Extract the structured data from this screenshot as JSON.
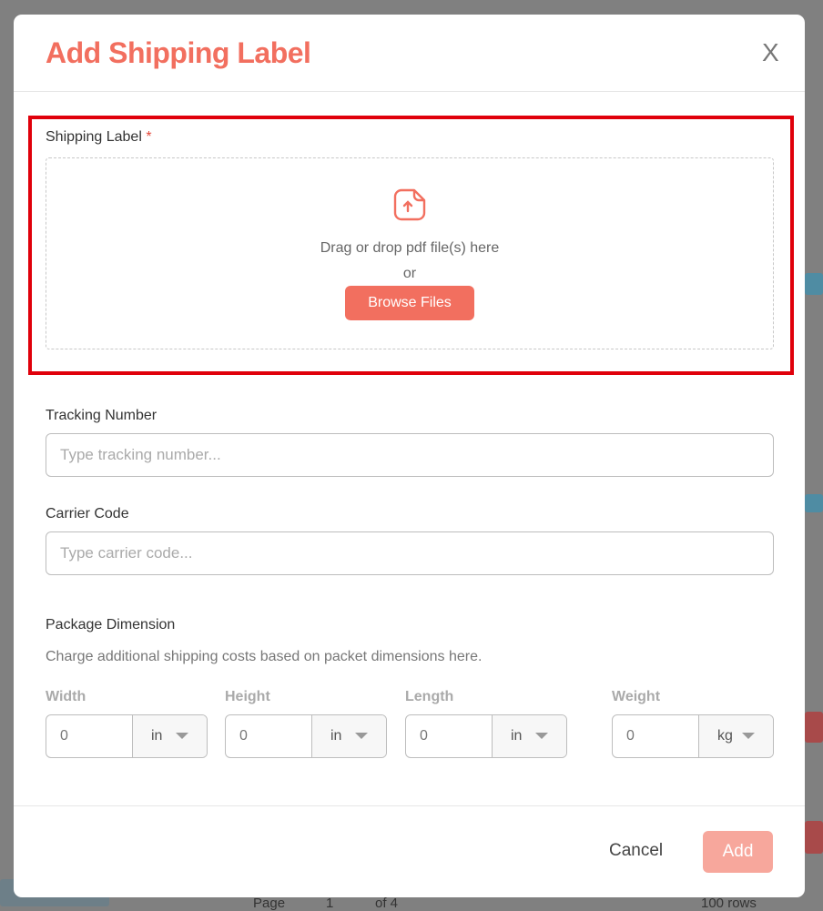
{
  "background": {
    "page_label": "Page",
    "page_value": "1",
    "page_of": "of 4",
    "rows_select": "100 rows"
  },
  "modal": {
    "title": "Add Shipping Label",
    "close_label": "X",
    "shipping_label": {
      "label": "Shipping Label",
      "required_mark": "*",
      "drop_text": "Drag or drop pdf file(s) here",
      "or_text": "or",
      "browse_label": "Browse Files",
      "icon": "file-upload-icon"
    },
    "tracking": {
      "label": "Tracking Number",
      "placeholder": "Type tracking number..."
    },
    "carrier": {
      "label": "Carrier Code",
      "placeholder": "Type carrier code..."
    },
    "package": {
      "label": "Package Dimension",
      "description": "Charge additional shipping costs based on packet dimensions here.",
      "fields": [
        {
          "label": "Width",
          "value": "0",
          "unit": "in"
        },
        {
          "label": "Height",
          "value": "0",
          "unit": "in"
        },
        {
          "label": "Length",
          "value": "0",
          "unit": "in"
        },
        {
          "label": "Weight",
          "value": "0",
          "unit": "kg"
        }
      ]
    },
    "cancel_label": "Cancel",
    "add_label": "Add"
  },
  "colors": {
    "accent": "#f26f5f",
    "highlight": "#e0000b",
    "add_disabled": "#f7a79c"
  }
}
